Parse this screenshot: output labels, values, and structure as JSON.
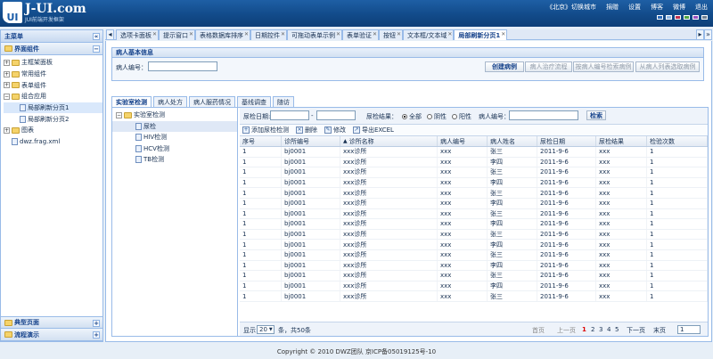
{
  "header": {
    "logo_mark": "UI",
    "brand": "J-UI.com",
    "subtitle": "JUI前端开发框架",
    "links": [
      "《北京》切换城市",
      "捐赠",
      "设置",
      "博客",
      "微博",
      "退出"
    ],
    "theme_colors": [
      "#2a69b8",
      "#8fb7e3",
      "#c03050",
      "#4fa542",
      "#9a4fc0",
      "#6f7f91"
    ]
  },
  "left": {
    "title": "主菜单",
    "group": "界面组件",
    "items": [
      "主框架面板",
      "常用组件",
      "表单组件",
      "组合应用",
      "局部刷新分页1",
      "局部刷新分页2",
      "图表",
      "dwz.frag.xml"
    ],
    "bottom": [
      "典型页面",
      "流程演示"
    ]
  },
  "tabs": [
    "选项卡面板",
    "提示窗口",
    "表格数据库排序",
    "日期控件",
    "可拖动表单示例",
    "表单验证",
    "按钮",
    "文本框/文本域",
    "局部刷新分页1"
  ],
  "info": {
    "title": "病人基本信息",
    "patient_label": "病人编号：",
    "buttons": [
      "创建病例",
      "病人治疗流程",
      "按病人编号检索病例",
      "从病人列表选取病例"
    ]
  },
  "subtabs": [
    "实验室检测",
    "病人处方",
    "病人服药情况",
    "基线调查",
    "随访"
  ],
  "subtree": [
    "实验室检测",
    "尿检",
    "HIV检测",
    "HCV检测",
    "TB检测"
  ],
  "search": {
    "date_label": "尿检日期:",
    "dash": "-",
    "result_label": "尿检结果：",
    "options": [
      "全部",
      "阴性",
      "阳性"
    ],
    "patient_label": "病人编号：",
    "search_btn": "检索"
  },
  "toolbar": [
    "添加尿检检测",
    "删除",
    "修改",
    "导出EXCEL"
  ],
  "table": {
    "headers": [
      "序号",
      "诊所编号",
      "诊所名称",
      "病人编号",
      "病人姓名",
      "尿检日期",
      "尿检结果",
      "检验次数"
    ],
    "rows": [
      [
        "1",
        "bj0001",
        "xxx诊所",
        "xxx",
        "张三",
        "2011-9-6",
        "xxx",
        "1"
      ],
      [
        "1",
        "bj0001",
        "xxx诊所",
        "xxx",
        "李四",
        "2011-9-6",
        "xxx",
        "1"
      ],
      [
        "1",
        "bj0001",
        "xxx诊所",
        "xxx",
        "张三",
        "2011-9-6",
        "xxx",
        "1"
      ],
      [
        "1",
        "bj0001",
        "xxx诊所",
        "xxx",
        "李四",
        "2011-9-6",
        "xxx",
        "1"
      ],
      [
        "1",
        "bj0001",
        "xxx诊所",
        "xxx",
        "张三",
        "2011-9-6",
        "xxx",
        "1"
      ],
      [
        "1",
        "bj0001",
        "xxx诊所",
        "xxx",
        "李四",
        "2011-9-6",
        "xxx",
        "1"
      ],
      [
        "1",
        "bj0001",
        "xxx诊所",
        "xxx",
        "张三",
        "2011-9-6",
        "xxx",
        "1"
      ],
      [
        "1",
        "bj0001",
        "xxx诊所",
        "xxx",
        "李四",
        "2011-9-6",
        "xxx",
        "1"
      ],
      [
        "1",
        "bj0001",
        "xxx诊所",
        "xxx",
        "张三",
        "2011-9-6",
        "xxx",
        "1"
      ],
      [
        "1",
        "bj0001",
        "xxx诊所",
        "xxx",
        "李四",
        "2011-9-6",
        "xxx",
        "1"
      ],
      [
        "1",
        "bj0001",
        "xxx诊所",
        "xxx",
        "张三",
        "2011-9-6",
        "xxx",
        "1"
      ],
      [
        "1",
        "bj0001",
        "xxx诊所",
        "xxx",
        "李四",
        "2011-9-6",
        "xxx",
        "1"
      ],
      [
        "1",
        "bj0001",
        "xxx诊所",
        "xxx",
        "张三",
        "2011-9-6",
        "xxx",
        "1"
      ],
      [
        "1",
        "bj0001",
        "xxx诊所",
        "xxx",
        "李四",
        "2011-9-6",
        "xxx",
        "1"
      ],
      [
        "1",
        "bj0001",
        "xxx诊所",
        "xxx",
        "张三",
        "2011-9-6",
        "xxx",
        "1"
      ]
    ]
  },
  "pager": {
    "show": "显示",
    "page_size": "20",
    "total": "条，共50条",
    "first": "首页",
    "prev": "上一页",
    "pages": [
      "1",
      "2",
      "3",
      "4",
      "5"
    ],
    "next": "下一页",
    "last": "末页",
    "goto": "1"
  },
  "footer": "Copyright © 2010 DWZ团队 京ICP备05019125号-10"
}
